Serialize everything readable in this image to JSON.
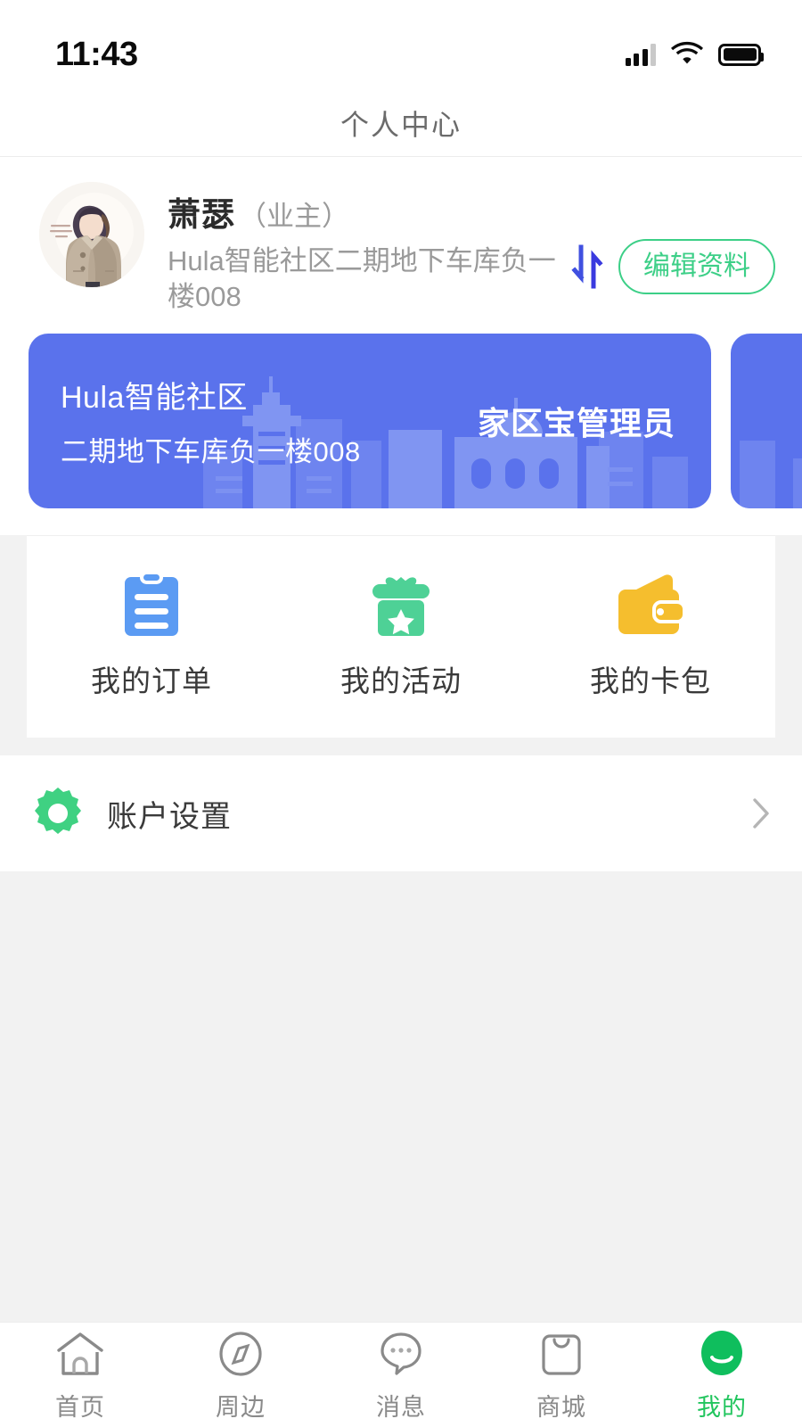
{
  "statusbar": {
    "time": "11:43",
    "signal_icon": "cellular-signal-icon",
    "wifi_icon": "wifi-icon",
    "battery_icon": "battery-icon"
  },
  "header": {
    "title": "个人中心"
  },
  "profile": {
    "avatar_alt": "user-avatar",
    "name": "萧瑟",
    "role": "（业主）",
    "address": "Hula智能社区二期地下车库负一楼008",
    "switch_icon": "switch-account-icon",
    "edit_button": "编辑资料"
  },
  "community_cards": [
    {
      "line1": "Hula智能社区",
      "line2": "二期地下车库负一楼008",
      "role": "家区宝管理员"
    },
    {
      "line1": "",
      "line2": "",
      "role": ""
    }
  ],
  "quick_actions": [
    {
      "label": "我的订单",
      "icon": "clipboard-icon",
      "color": "#5B9BF3"
    },
    {
      "label": "我的活动",
      "icon": "gift-icon",
      "color": "#4ED196"
    },
    {
      "label": "我的卡包",
      "icon": "wallet-icon",
      "color": "#F5BE2E"
    }
  ],
  "settings": {
    "label": "账户设置",
    "icon": "gear-icon",
    "icon_color": "#3FD182",
    "chevron": "chevron-right-icon"
  },
  "tabbar": [
    {
      "label": "首页",
      "icon": "home-icon",
      "active": false
    },
    {
      "label": "周边",
      "icon": "compass-icon",
      "active": false
    },
    {
      "label": "消息",
      "icon": "chat-icon",
      "active": false
    },
    {
      "label": "商城",
      "icon": "shop-bag-icon",
      "active": false
    },
    {
      "label": "我的",
      "icon": "profile-icon",
      "active": true
    }
  ],
  "colors": {
    "accent_green": "#3ccf87",
    "active_green": "#22c55e",
    "card_blue": "#5a72ec",
    "page_bg": "#f2f2f2"
  }
}
